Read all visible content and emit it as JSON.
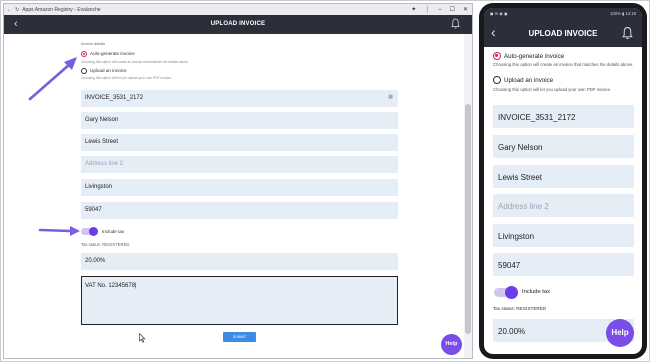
{
  "window": {
    "title": "Apps Amazon Registry - Evalanche",
    "controls": [
      "–",
      "☐",
      "✕"
    ]
  },
  "header": {
    "title": "UPLOAD INVOICE"
  },
  "form": {
    "section_label": "Invoice details",
    "radio_auto_label": "Auto-generate invoice",
    "radio_auto_help": "Choosing this option will create an invoice that matches the details above.",
    "radio_upload_label": "Upload an invoice",
    "radio_upload_help": "Choosing this option will let you upload your own PDF invoice.",
    "invoice_number": "INVOICE_3531_2172",
    "name": "Gary Nelson",
    "address_line_1": "Lewis Street",
    "address_line_2_placeholder": "Address line 2",
    "city": "Livingston",
    "postcode": "59047",
    "include_tax_label": "Include tax",
    "tax_status": "Tax status: REGISTERED",
    "tax_rate": "20.00%",
    "notes": "VAT No. 12345678|",
    "submit_label": "SUBMIT"
  },
  "help_label": "Help",
  "phone": {
    "status_left": "◼ ✉ ◉ ◼",
    "status_right": "100% ▮ 12:18",
    "help_auto": "Choosing this option will create an invoice that matches the details above.",
    "help_upload": "Choosing this option will let you upload your own PDF invoice."
  },
  "colors": {
    "appbar": "#2c2e3a",
    "field_bg": "#e5eef7",
    "accent_purple": "#7a4de8",
    "radio_selected": "#d0245e",
    "submit_blue": "#3c8ce6",
    "annotation_arrow": "#7a5ce0"
  },
  "icons": [
    "back-chevron-icon",
    "bell-icon",
    "calendar-icon",
    "mouse-cursor-icon",
    "annotation-arrow-icon"
  ]
}
